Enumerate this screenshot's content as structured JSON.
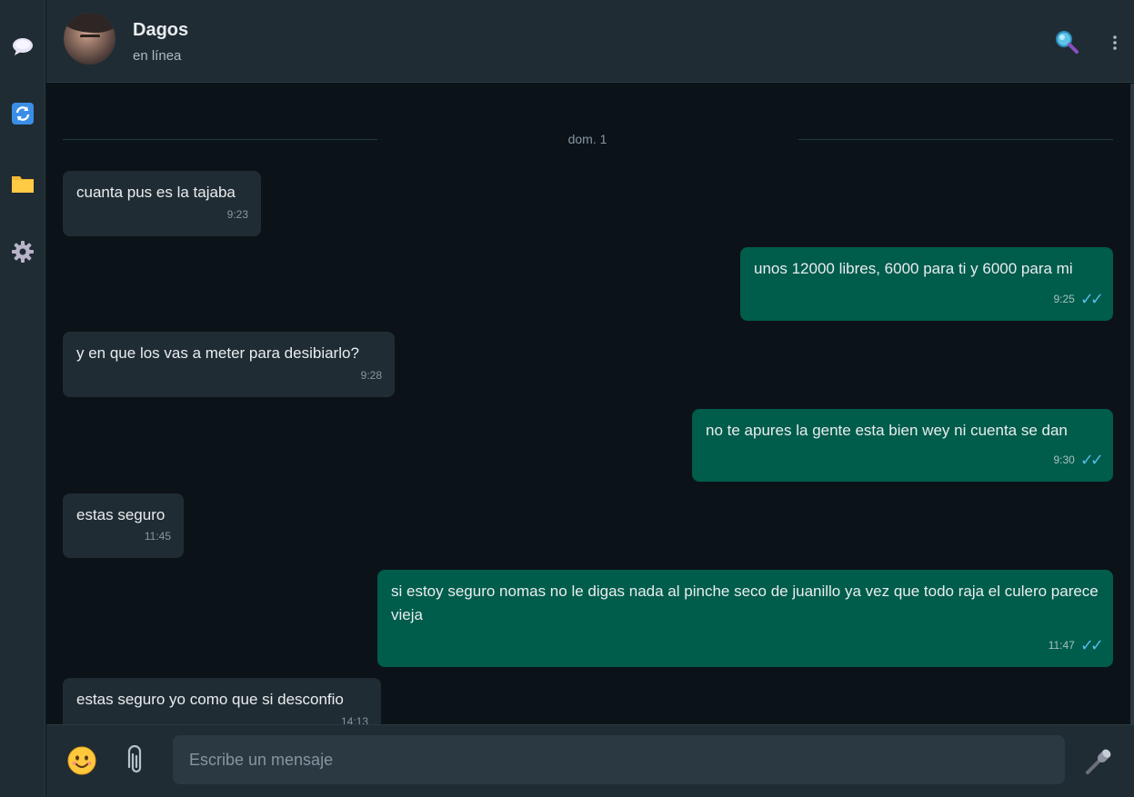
{
  "contact": {
    "name": "Dagos",
    "status": "en línea"
  },
  "date_divider": "dom. 1",
  "messages": [
    {
      "dir": "in",
      "text": "cuanta pus es la tajaba",
      "time": "9:23"
    },
    {
      "dir": "out",
      "text": "unos 12000 libres, 6000 para ti y 6000 para mi",
      "time": "9:25"
    },
    {
      "dir": "in",
      "text": "y en que los vas a meter para desibiarlo?",
      "time": "9:28"
    },
    {
      "dir": "out",
      "text": "no te apures la gente esta bien wey ni cuenta se dan",
      "time": "9:30"
    },
    {
      "dir": "in",
      "text": "estas seguro",
      "time": "11:45"
    },
    {
      "dir": "out",
      "text": "si estoy seguro nomas no le digas nada al pinche seco de juanillo ya vez que todo raja el culero parece vieja",
      "time": "11:47"
    },
    {
      "dir": "in",
      "text": "estas seguro yo como que si desconfio",
      "time": "14:13"
    }
  ],
  "composer": {
    "placeholder": "Escribe un mensaje"
  },
  "icons": {
    "rail": [
      "chat-bubble-icon",
      "refresh-icon",
      "folder-icon",
      "gear-icon"
    ],
    "header": [
      "search-icon",
      "more-vertical-icon"
    ],
    "footer": [
      "emoji-icon",
      "paperclip-icon",
      "microphone-icon"
    ]
  },
  "colors": {
    "incoming": "#202c33",
    "outgoing": "#005c4b",
    "read_ticks": "#53bdeb",
    "background": "#0c1318"
  }
}
